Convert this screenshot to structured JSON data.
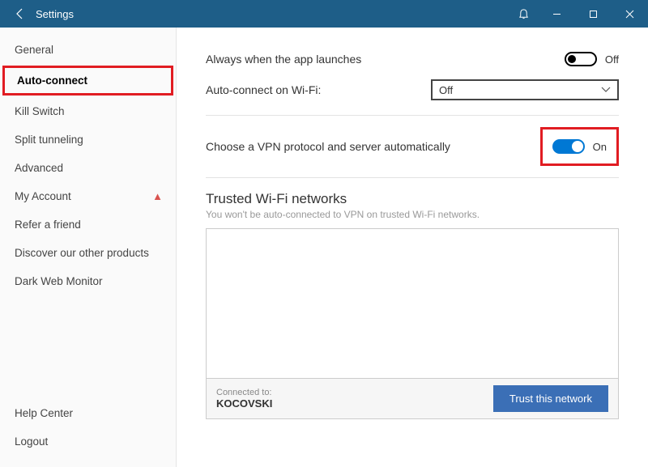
{
  "titlebar": {
    "title": "Settings"
  },
  "sidebar": {
    "items": [
      {
        "label": "General",
        "name": "sidebar-item-general"
      },
      {
        "label": "Auto-connect",
        "name": "sidebar-item-auto-connect",
        "active": true
      },
      {
        "label": "Kill Switch",
        "name": "sidebar-item-kill-switch"
      },
      {
        "label": "Split tunneling",
        "name": "sidebar-item-split-tunneling"
      },
      {
        "label": "Advanced",
        "name": "sidebar-item-advanced"
      },
      {
        "label": "My Account",
        "name": "sidebar-item-my-account",
        "warn": true
      },
      {
        "label": "Refer a friend",
        "name": "sidebar-item-refer"
      },
      {
        "label": "Discover our other products",
        "name": "sidebar-item-discover"
      },
      {
        "label": "Dark Web Monitor",
        "name": "sidebar-item-darkweb"
      }
    ],
    "bottom": [
      {
        "label": "Help Center",
        "name": "sidebar-item-help"
      },
      {
        "label": "Logout",
        "name": "sidebar-item-logout"
      }
    ]
  },
  "settings": {
    "always_launch": {
      "label": "Always when the app launches",
      "state": "Off"
    },
    "wifi_autoconnect": {
      "label": "Auto-connect on Wi-Fi:",
      "value": "Off"
    },
    "vpn_auto": {
      "label": "Choose a VPN protocol and server automatically",
      "state": "On"
    }
  },
  "trusted": {
    "title": "Trusted Wi-Fi networks",
    "subtitle": "You won't be auto-connected to VPN on trusted Wi-Fi networks.",
    "connected_label": "Connected to:",
    "connected_name": "KOCOVSKI",
    "button": "Trust this network"
  }
}
